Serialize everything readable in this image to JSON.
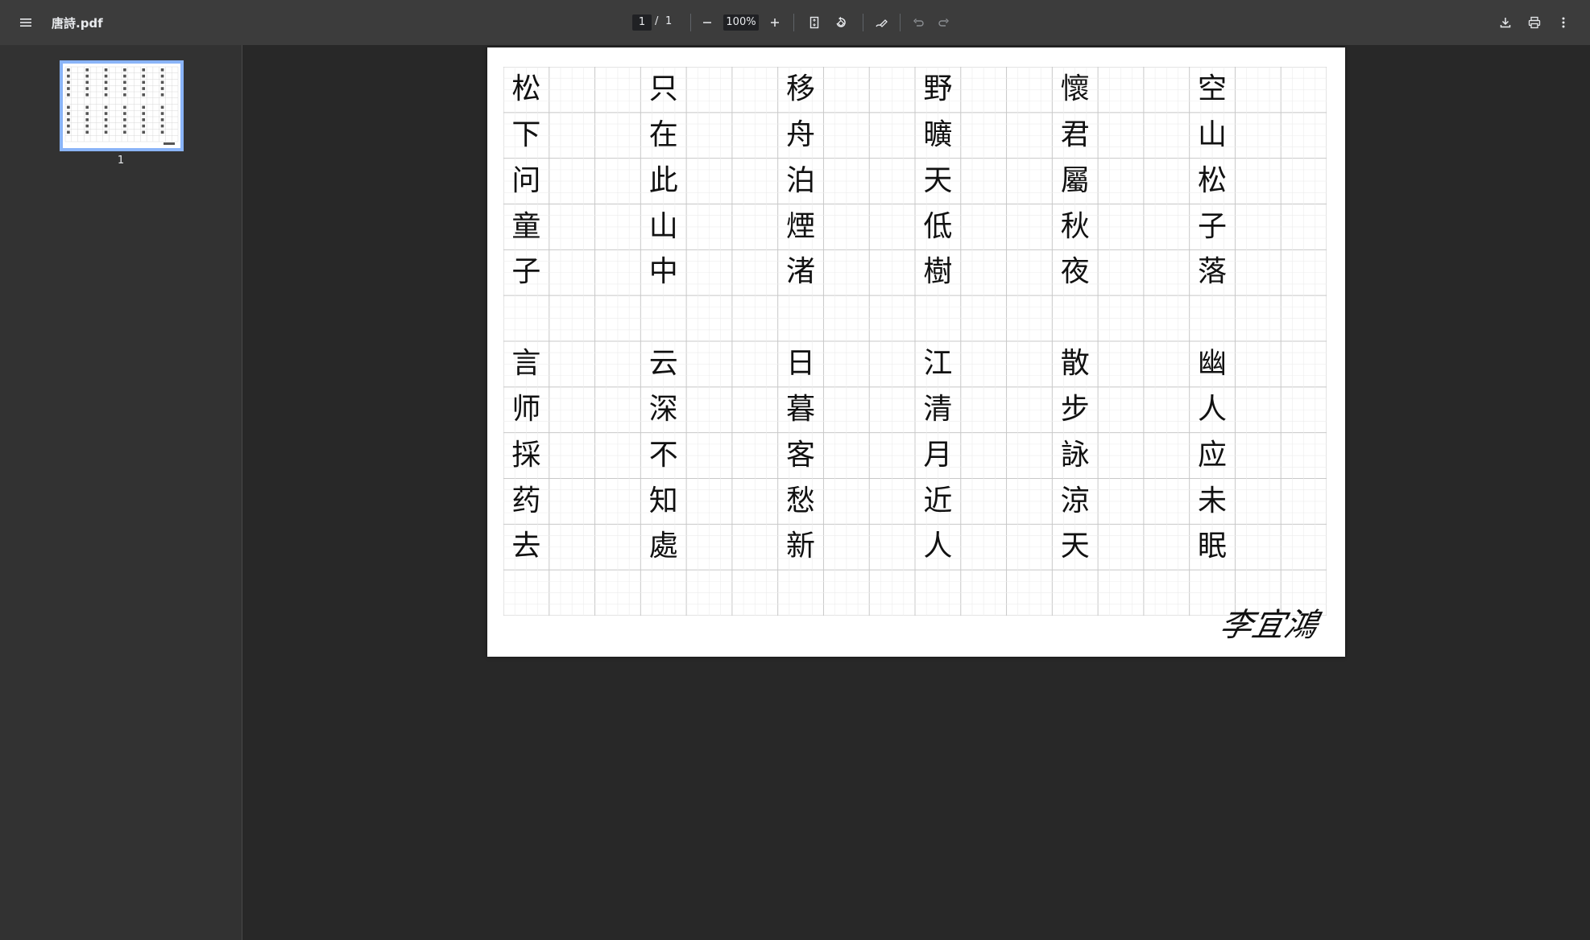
{
  "toolbar": {
    "menu_icon": "hamburger-menu-icon",
    "file_title": "唐詩.pdf",
    "current_page": "1",
    "page_separator": "/",
    "total_pages": "1",
    "zoom": "100%",
    "zoom_out_icon": "minus-icon",
    "zoom_in_icon": "plus-icon",
    "fit_page_icon": "fit-page-icon",
    "rotate_icon": "rotate-icon",
    "annotate_icon": "pen-annotate-icon",
    "undo_icon": "undo-icon",
    "redo_icon": "redo-icon",
    "download_icon": "download-icon",
    "print_icon": "print-icon",
    "more_icon": "more-vertical-icon"
  },
  "sidebar": {
    "thumbnails": [
      {
        "label": "1",
        "selected": true
      }
    ]
  },
  "document": {
    "columns": [
      {
        "top": [
          "松",
          "下",
          "问",
          "童",
          "子"
        ],
        "bottom": [
          "言",
          "师",
          "採",
          "药",
          "去"
        ]
      },
      {
        "top": [
          "只",
          "在",
          "此",
          "山",
          "中"
        ],
        "bottom": [
          "云",
          "深",
          "不",
          "知",
          "處"
        ]
      },
      {
        "top": [
          "移",
          "舟",
          "泊",
          "煙",
          "渚"
        ],
        "bottom": [
          "日",
          "暮",
          "客",
          "愁",
          "新"
        ]
      },
      {
        "top": [
          "野",
          "曠",
          "天",
          "低",
          "樹"
        ],
        "bottom": [
          "江",
          "清",
          "月",
          "近",
          "人"
        ]
      },
      {
        "top": [
          "懷",
          "君",
          "屬",
          "秋",
          "夜"
        ],
        "bottom": [
          "散",
          "步",
          "詠",
          "涼",
          "天"
        ]
      },
      {
        "top": [
          "空",
          "山",
          "松",
          "子",
          "落"
        ],
        "bottom": [
          "幽",
          "人",
          "应",
          "未",
          "眠"
        ]
      }
    ],
    "signature": "李宜鴻"
  },
  "colors": {
    "toolbar_bg": "#3c3c3c",
    "sidebar_bg": "#323232",
    "viewer_bg": "#282828",
    "thumbnail_border": "#8ab4f8",
    "grid_line": "#c8c8c8",
    "ink": "#111111"
  }
}
